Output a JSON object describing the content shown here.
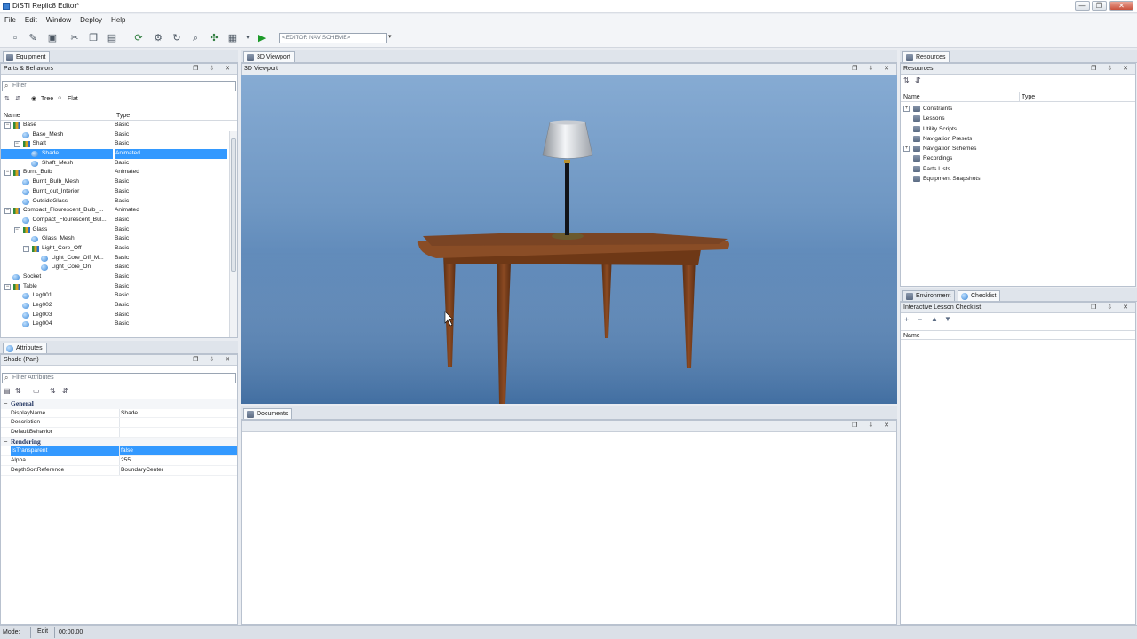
{
  "window": {
    "title": "DiSTI Replic8 Editor*",
    "controls": [
      "—",
      "❐",
      "✕"
    ]
  },
  "menu": [
    "File",
    "Edit",
    "Window",
    "Deploy",
    "Help"
  ],
  "toolbar": {
    "nav_scheme": "<EDITOR NAV SCHEME>"
  },
  "left_top": {
    "tab": "Equipment",
    "panel_title": "Parts & Behaviors",
    "filter_placeholder": "Filter",
    "view_tree": "Tree",
    "view_flat": "Flat",
    "col_name": "Name",
    "col_type": "Type",
    "rows": [
      {
        "name": "Base",
        "type": "Basic",
        "level": 0,
        "icon": "group",
        "exp": "−"
      },
      {
        "name": "Base_Mesh",
        "type": "Basic",
        "level": 1,
        "icon": "mesh",
        "exp": ""
      },
      {
        "name": "Shaft",
        "type": "Basic",
        "level": 1,
        "icon": "group",
        "exp": "−"
      },
      {
        "name": "Shade",
        "type": "Animated",
        "level": 2,
        "icon": "mesh",
        "exp": "",
        "selected": true
      },
      {
        "name": "Shaft_Mesh",
        "type": "Basic",
        "level": 2,
        "icon": "mesh",
        "exp": ""
      },
      {
        "name": "Burnt_Bulb",
        "type": "Animated",
        "level": 0,
        "icon": "group",
        "exp": "−"
      },
      {
        "name": "Burnt_Bulb_Mesh",
        "type": "Basic",
        "level": 1,
        "icon": "mesh",
        "exp": ""
      },
      {
        "name": "Burnt_out_Interior",
        "type": "Basic",
        "level": 1,
        "icon": "mesh",
        "exp": ""
      },
      {
        "name": "OutsideGlass",
        "type": "Basic",
        "level": 1,
        "icon": "mesh",
        "exp": ""
      },
      {
        "name": "Compact_Flourescent_Bulb_...",
        "type": "Animated",
        "level": 0,
        "icon": "group",
        "exp": "−"
      },
      {
        "name": "Compact_Flourescent_Bul...",
        "type": "Basic",
        "level": 1,
        "icon": "mesh",
        "exp": ""
      },
      {
        "name": "Glass",
        "type": "Basic",
        "level": 1,
        "icon": "group",
        "exp": "−"
      },
      {
        "name": "Glass_Mesh",
        "type": "Basic",
        "level": 2,
        "icon": "mesh",
        "exp": ""
      },
      {
        "name": "Light_Core_Off",
        "type": "Basic",
        "level": 2,
        "icon": "group",
        "exp": "−"
      },
      {
        "name": "Light_Core_Off_M...",
        "type": "Basic",
        "level": 3,
        "icon": "mesh",
        "exp": ""
      },
      {
        "name": "Light_Core_On",
        "type": "Basic",
        "level": 3,
        "icon": "mesh",
        "exp": ""
      },
      {
        "name": "Socket",
        "type": "Basic",
        "level": 0,
        "icon": "mesh",
        "exp": ""
      },
      {
        "name": "Table",
        "type": "Basic",
        "level": 0,
        "icon": "group",
        "exp": "−"
      },
      {
        "name": "Leg001",
        "type": "Basic",
        "level": 1,
        "icon": "mesh",
        "exp": ""
      },
      {
        "name": "Leg002",
        "type": "Basic",
        "level": 1,
        "icon": "mesh",
        "exp": ""
      },
      {
        "name": "Leg003",
        "type": "Basic",
        "level": 1,
        "icon": "mesh",
        "exp": ""
      },
      {
        "name": "Leg004",
        "type": "Basic",
        "level": 1,
        "icon": "mesh",
        "exp": ""
      }
    ]
  },
  "left_bottom": {
    "tab": "Attributes",
    "panel_title": "Shade (Part)",
    "filter_placeholder": "Filter Attributes",
    "categories": [
      {
        "name": "General",
        "rows": [
          {
            "key": "DisplayName",
            "value": "Shade"
          },
          {
            "key": "Description",
            "value": ""
          },
          {
            "key": "DefaultBehavior",
            "value": ""
          }
        ]
      },
      {
        "name": "Rendering",
        "rows": [
          {
            "key": "IsTransparent",
            "value": "false",
            "selected": true
          },
          {
            "key": "Alpha",
            "value": "255"
          },
          {
            "key": "DepthSortReference",
            "value": "BoundaryCenter"
          }
        ]
      }
    ]
  },
  "center": {
    "tab": "3D Viewport",
    "panel_title": "3D Viewport",
    "documents_tab": "Documents"
  },
  "right_top": {
    "tab": "Resources",
    "panel_title": "Resources",
    "col_name": "Name",
    "col_type": "Type",
    "items": [
      {
        "name": "Constraints",
        "exp": "+"
      },
      {
        "name": "Lessons",
        "exp": ""
      },
      {
        "name": "Utility Scripts",
        "exp": ""
      },
      {
        "name": "Navigation Presets",
        "exp": ""
      },
      {
        "name": "Navigation Schemes",
        "exp": "+"
      },
      {
        "name": "Recordings",
        "exp": ""
      },
      {
        "name": "Parts Lists",
        "exp": ""
      },
      {
        "name": "Equipment Snapshots",
        "exp": ""
      }
    ]
  },
  "right_bottom": {
    "tab_environment": "Environment",
    "tab_checklist": "Checklist",
    "panel_title": "Interactive Lesson Checklist",
    "col_name": "Name"
  },
  "status": {
    "mode_label": "Mode:",
    "mode_value": "Edit",
    "time": "00:00.00"
  }
}
